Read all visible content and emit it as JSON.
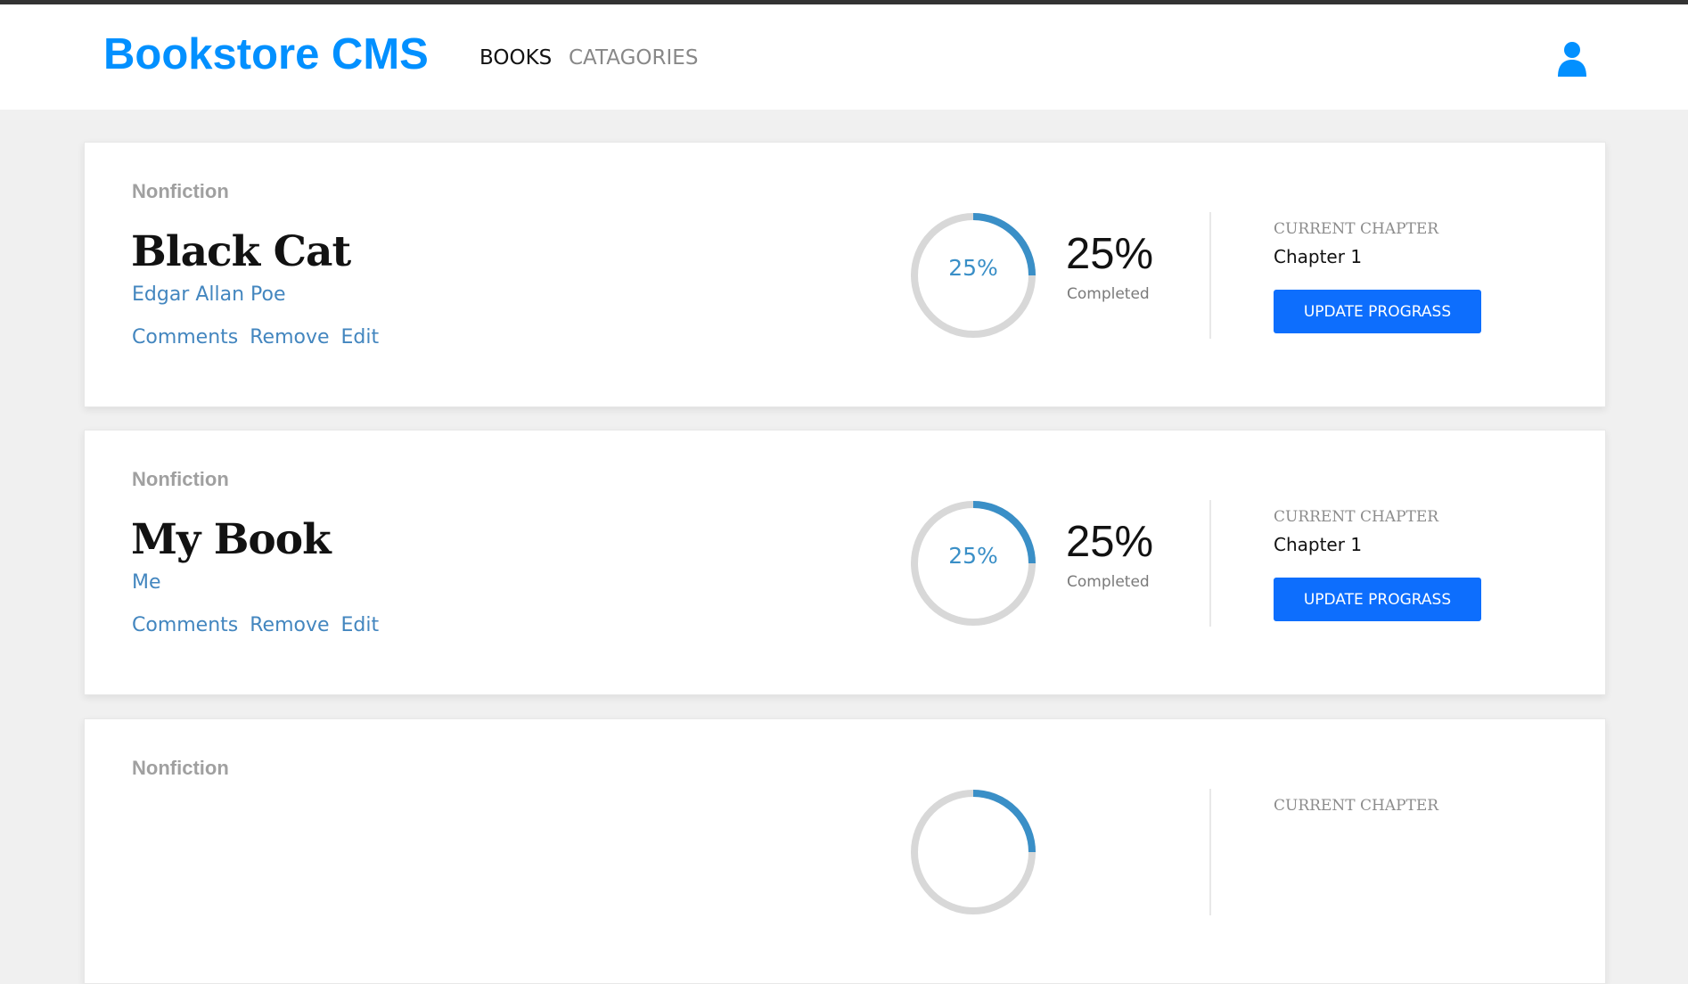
{
  "header": {
    "brand": "Bookstore CMS",
    "nav": [
      {
        "label": "BOOKS"
      },
      {
        "label": "CATAGORIES"
      }
    ],
    "user_icon": "user-icon"
  },
  "colors": {
    "brand": "#0290ff",
    "link": "#4386bf",
    "progress": "#3a8fc7",
    "button": "#0d6efd"
  },
  "books": [
    {
      "genre": "Nonfiction",
      "title": "Black Cat",
      "author": "Edgar Allan Poe",
      "actions": [
        "Comments",
        "Remove",
        "Edit"
      ],
      "progress": 0.25,
      "progress_label": "25%",
      "percent": "25%",
      "completed_label": "Completed",
      "chapter_label": "CURRENT CHAPTER",
      "chapter": "Chapter 1",
      "button_label": "UPDATE PROGRASS"
    },
    {
      "genre": "Nonfiction",
      "title": "My Book",
      "author": "Me",
      "actions": [
        "Comments",
        "Remove",
        "Edit"
      ],
      "progress": 0.25,
      "progress_label": "25%",
      "percent": "25%",
      "completed_label": "Completed",
      "chapter_label": "CURRENT CHAPTER",
      "chapter": "Chapter 1",
      "button_label": "UPDATE PROGRASS"
    },
    {
      "genre": "Nonfiction",
      "title": "",
      "author": "",
      "actions": [],
      "progress": 0.25,
      "progress_label": "",
      "percent": "",
      "completed_label": "",
      "chapter_label": "CURRENT CHAPTER",
      "chapter": "",
      "button_label": ""
    }
  ]
}
